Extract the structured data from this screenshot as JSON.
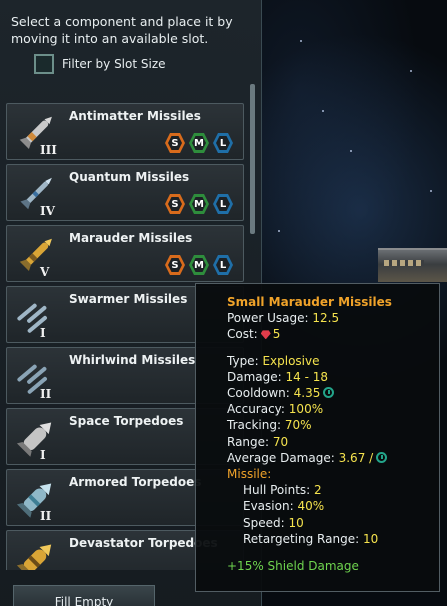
{
  "panel": {
    "instructions": "Select a component and place it by moving it into an available slot.",
    "filter_label": "Filter by Slot Size",
    "fill_button": "Fill Empty"
  },
  "components": [
    {
      "name": "Antimatter Missiles",
      "tier": "III",
      "sizes": [
        "S",
        "M",
        "L"
      ]
    },
    {
      "name": "Quantum Missiles",
      "tier": "IV",
      "sizes": [
        "S",
        "M",
        "L"
      ]
    },
    {
      "name": "Marauder Missiles",
      "tier": "V",
      "sizes": [
        "S",
        "M",
        "L"
      ]
    },
    {
      "name": "Swarmer Missiles",
      "tier": "I",
      "sizes": []
    },
    {
      "name": "Whirlwind Missiles",
      "tier": "II",
      "sizes": []
    },
    {
      "name": "Space Torpedoes",
      "tier": "I",
      "sizes": []
    },
    {
      "name": "Armored Torpedoes",
      "tier": "II",
      "sizes": []
    },
    {
      "name": "Devastator Torpedoes",
      "tier": "",
      "sizes": []
    }
  ],
  "tooltip": {
    "title": "Small Marauder Missiles",
    "power_label": "Power Usage:",
    "power_value": "12.5",
    "cost_label": "Cost:",
    "cost_value": "5",
    "type_label": "Type:",
    "type_value": "Explosive",
    "damage_label": "Damage:",
    "damage_value": "14 - 18",
    "cooldown_label": "Cooldown:",
    "cooldown_value": "4.35",
    "accuracy_label": "Accuracy:",
    "accuracy_value": "100%",
    "tracking_label": "Tracking:",
    "tracking_value": "70%",
    "range_label": "Range:",
    "range_value": "70",
    "avg_damage_label": "Average Damage:",
    "avg_damage_value": "3.67 /",
    "missile_section": "Missile:",
    "hull_label": "Hull Points:",
    "hull_value": "2",
    "evasion_label": "Evasion:",
    "evasion_value": "40%",
    "speed_label": "Speed:",
    "speed_value": "10",
    "retarget_label": "Retargeting Range:",
    "retarget_value": "10",
    "bonus": "+15% Shield Damage"
  },
  "colors": {
    "accent_orange": "#f0a32a",
    "value_yellow": "#f5e34e",
    "bonus_green": "#6fd44f",
    "size_s": "#d86b1c",
    "size_m": "#2e8d3c",
    "size_l": "#1f6fa8"
  },
  "icons": {
    "missile": "missile-icon",
    "torpedo": "torpedo-icon",
    "energy": "energy-gem-icon",
    "cooldown": "clock-icon"
  }
}
